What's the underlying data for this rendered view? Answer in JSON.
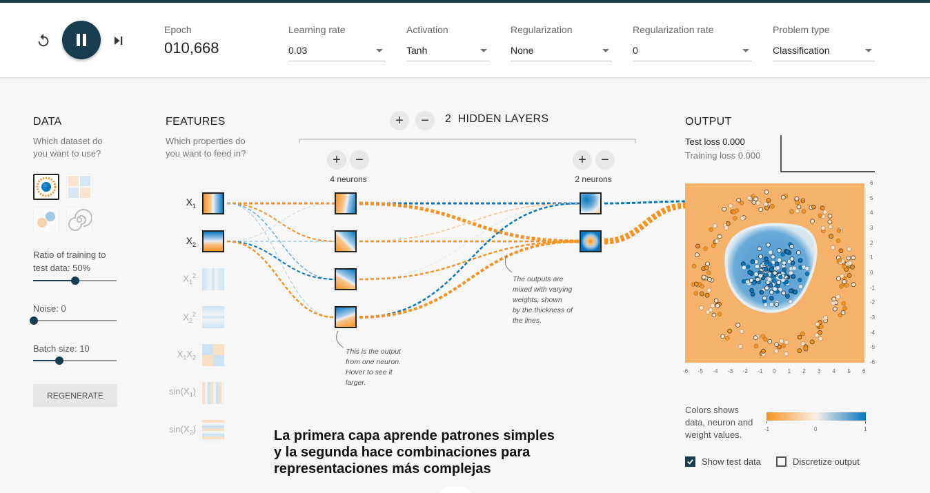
{
  "header": {
    "epoch_label": "Epoch",
    "epoch_value": "010,668",
    "params": [
      {
        "label": "Learning rate",
        "value": "0.03"
      },
      {
        "label": "Activation",
        "value": "Tanh"
      },
      {
        "label": "Regularization",
        "value": "None"
      },
      {
        "label": "Regularization rate",
        "value": "0"
      },
      {
        "label": "Problem type",
        "value": "Classification"
      }
    ]
  },
  "data_panel": {
    "title": "DATA",
    "subtitle_1": "Which dataset do",
    "subtitle_2": "you want to use?",
    "ratio_label_1": "Ratio of training to",
    "ratio_label_2": "test data:  50%",
    "ratio_percent": 50,
    "noise_label": "Noise:  0",
    "noise_value": 0,
    "batch_label": "Batch size:  10",
    "batch_value": 10,
    "regenerate_label": "REGENERATE"
  },
  "features_panel": {
    "title": "FEATURES",
    "subtitle_1": "Which properties do",
    "subtitle_2": "you want to feed in?"
  },
  "network": {
    "layers_count": "2",
    "layers_label": "HIDDEN LAYERS",
    "layer1_neurons": "4 neurons",
    "layer2_neurons": "2 neurons",
    "note_neuron": [
      "This is the output",
      "from one neuron.",
      "Hover to see it",
      "larger."
    ],
    "note_weights": [
      "The outputs are",
      "mixed with varying",
      "weights, shown",
      "by the thickness of",
      "the lines."
    ]
  },
  "output_panel": {
    "title": "OUTPUT",
    "test_loss": "Test loss 0.000",
    "training_loss": "Training loss 0.000",
    "y_ticks": [
      "6",
      "5",
      "4",
      "3",
      "2",
      "1",
      "0",
      "-1",
      "-2",
      "-3",
      "-4",
      "-5",
      "-6"
    ],
    "x_ticks": [
      "-6",
      "-5",
      "-4",
      "-3",
      "-2",
      "-1",
      "0",
      "1",
      "2",
      "3",
      "4",
      "5",
      "6"
    ],
    "legend_text_1": "Colors shows",
    "legend_text_2": "data, neuron and",
    "legend_text_3": "weight values.",
    "legend_min": "-1",
    "legend_mid": "0",
    "legend_max": "1",
    "show_test_data": "Show test data",
    "show_test_checked": true,
    "discretize": "Discretize output",
    "discretize_checked": false
  },
  "caption": {
    "line1": "La primera capa aprende patrones simples",
    "line2": "y la segunda hace combinaciones para",
    "line3": "representaciones más complejas"
  },
  "colors": {
    "accent": "#183d4e",
    "orange": "#f59322",
    "blue": "#0877bd"
  }
}
